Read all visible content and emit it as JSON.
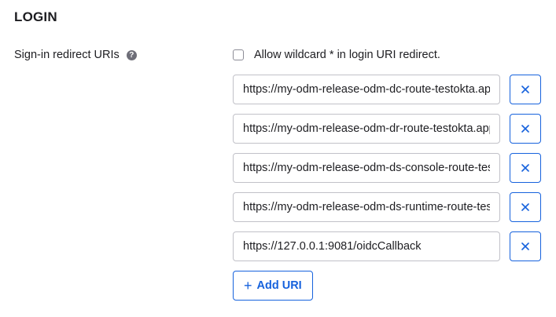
{
  "section": {
    "title": "LOGIN"
  },
  "field": {
    "label": "Sign-in redirect URIs",
    "help_icon": "question-circle-icon",
    "help_glyph": "?"
  },
  "wildcard": {
    "checked": false,
    "label": "Allow wildcard * in login URI redirect."
  },
  "uris": [
    {
      "value": "https://my-odm-release-odm-dc-route-testokta.apps"
    },
    {
      "value": "https://my-odm-release-odm-dr-route-testokta.apps"
    },
    {
      "value": "https://my-odm-release-odm-ds-console-route-testokta"
    },
    {
      "value": "https://my-odm-release-odm-ds-runtime-route-testokta"
    },
    {
      "value": "https://127.0.0.1:9081/oidcCallback"
    }
  ],
  "remove_icon": "close-icon",
  "add_button": {
    "icon": "plus-icon",
    "glyph": "+",
    "label": "Add URI"
  },
  "colors": {
    "accent": "#1662dd",
    "text": "#1d1d21",
    "border": "#c1c1c8"
  }
}
